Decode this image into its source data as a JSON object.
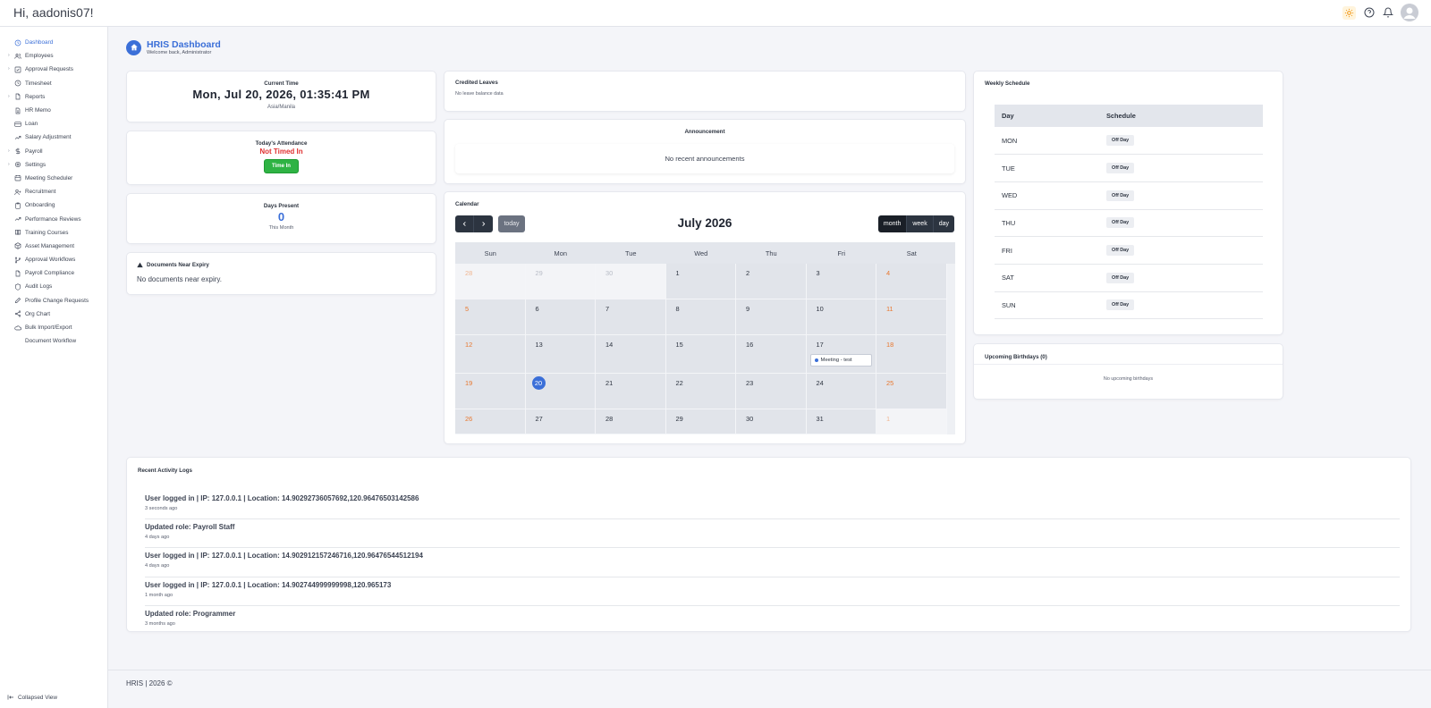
{
  "header": {
    "greeting": "Hi, aadonis07!",
    "icons": [
      "sun-icon",
      "help-icon",
      "bell-icon",
      "user-avatar"
    ]
  },
  "colors": {
    "accent": "#3b6fd8",
    "danger": "#e03131",
    "success": "#2fb344",
    "weekend": "#e8772e",
    "dark_button": "#2c3440"
  },
  "sidebar": {
    "items": [
      {
        "label": "Dashboard",
        "icon": "clock-icon",
        "expandable": false,
        "active": true
      },
      {
        "label": "Employees",
        "icon": "users-icon",
        "expandable": true,
        "active": false
      },
      {
        "label": "Approval Requests",
        "icon": "check-square-icon",
        "expandable": true,
        "active": false
      },
      {
        "label": "Timesheet",
        "icon": "clock-icon",
        "expandable": false,
        "active": false
      },
      {
        "label": "Reports",
        "icon": "file-icon",
        "expandable": true,
        "active": false
      },
      {
        "label": "HR Memo",
        "icon": "file-text-icon",
        "expandable": false,
        "active": false
      },
      {
        "label": "Loan",
        "icon": "credit-card-icon",
        "expandable": false,
        "active": false
      },
      {
        "label": "Salary Adjustment",
        "icon": "trending-up-icon",
        "expandable": false,
        "active": false
      },
      {
        "label": "Payroll",
        "icon": "dollar-icon",
        "expandable": true,
        "active": false
      },
      {
        "label": "Settings",
        "icon": "gear-icon",
        "expandable": true,
        "active": false
      },
      {
        "label": "Meeting Scheduler",
        "icon": "calendar-icon",
        "expandable": false,
        "active": false
      },
      {
        "label": "Recruitment",
        "icon": "user-plus-icon",
        "expandable": false,
        "active": false
      },
      {
        "label": "Onboarding",
        "icon": "clipboard-icon",
        "expandable": false,
        "active": false
      },
      {
        "label": "Performance Reviews",
        "icon": "trending-up-icon",
        "expandable": false,
        "active": false
      },
      {
        "label": "Training Courses",
        "icon": "book-icon",
        "expandable": false,
        "active": false
      },
      {
        "label": "Asset Management",
        "icon": "package-icon",
        "expandable": false,
        "active": false
      },
      {
        "label": "Approval Workflows",
        "icon": "git-branch-icon",
        "expandable": false,
        "active": false
      },
      {
        "label": "Payroll Compliance",
        "icon": "file-icon",
        "expandable": false,
        "active": false
      },
      {
        "label": "Audit Logs",
        "icon": "shield-icon",
        "expandable": false,
        "active": false
      },
      {
        "label": "Profile Change Requests",
        "icon": "edit-icon",
        "expandable": false,
        "active": false
      },
      {
        "label": "Org Chart",
        "icon": "share-icon",
        "expandable": false,
        "active": false
      },
      {
        "label": "Bulk Import/Export",
        "icon": "cloud-icon",
        "expandable": false,
        "active": false
      },
      {
        "label": "Document Workflow",
        "icon": "",
        "expandable": false,
        "active": false
      }
    ],
    "collapse_label": "Collapsed View"
  },
  "page": {
    "title": "HRIS Dashboard",
    "subtitle": "Welcome back, Administrator"
  },
  "current_time": {
    "label": "Current Time",
    "value": "Mon, Jul 20, 2026, 01:35:41 PM",
    "timezone": "Asia/Manila"
  },
  "attendance": {
    "label": "Today's Attendance",
    "status": "Not Timed In",
    "button": "Time In"
  },
  "days_present": {
    "label": "Days Present",
    "value": "0",
    "sub": "This Month"
  },
  "documents": {
    "title": "Documents Near Expiry",
    "message": "No documents near expiry."
  },
  "credited_leaves": {
    "title": "Credited Leaves",
    "message": "No leave balance data"
  },
  "announcement": {
    "title": "Announcement",
    "message": "No recent announcements"
  },
  "calendar": {
    "title": "Calendar",
    "month_title": "July 2026",
    "prev": "‹",
    "next": "›",
    "today": "today",
    "views": [
      "month",
      "week",
      "day"
    ],
    "active_view": "month",
    "weekdays": [
      "Sun",
      "Mon",
      "Tue",
      "Wed",
      "Thu",
      "Fri",
      "Sat"
    ],
    "weeks": [
      [
        {
          "d": "28",
          "o": true
        },
        {
          "d": "29",
          "o": true
        },
        {
          "d": "30",
          "o": true
        },
        {
          "d": "1"
        },
        {
          "d": "2"
        },
        {
          "d": "3"
        },
        {
          "d": "4"
        }
      ],
      [
        {
          "d": "5"
        },
        {
          "d": "6"
        },
        {
          "d": "7"
        },
        {
          "d": "8"
        },
        {
          "d": "9"
        },
        {
          "d": "10"
        },
        {
          "d": "11"
        }
      ],
      [
        {
          "d": "12"
        },
        {
          "d": "13"
        },
        {
          "d": "14"
        },
        {
          "d": "15"
        },
        {
          "d": "16"
        },
        {
          "d": "17",
          "event": "Meeting - test"
        },
        {
          "d": "18"
        }
      ],
      [
        {
          "d": "19"
        },
        {
          "d": "20",
          "today": true
        },
        {
          "d": "21"
        },
        {
          "d": "22"
        },
        {
          "d": "23"
        },
        {
          "d": "24"
        },
        {
          "d": "25"
        }
      ],
      [
        {
          "d": "26"
        },
        {
          "d": "27"
        },
        {
          "d": "28"
        },
        {
          "d": "29"
        },
        {
          "d": "30"
        },
        {
          "d": "31"
        },
        {
          "d": "1",
          "o": true
        }
      ]
    ]
  },
  "weekly_schedule": {
    "title": "Weekly Schedule",
    "columns": [
      "Day",
      "Schedule"
    ],
    "rows": [
      {
        "day": "MON",
        "schedule": "Off Day"
      },
      {
        "day": "TUE",
        "schedule": "Off Day"
      },
      {
        "day": "WED",
        "schedule": "Off Day"
      },
      {
        "day": "THU",
        "schedule": "Off Day"
      },
      {
        "day": "FRI",
        "schedule": "Off Day"
      },
      {
        "day": "SAT",
        "schedule": "Off Day"
      },
      {
        "day": "SUN",
        "schedule": "Off Day"
      }
    ]
  },
  "birthdays": {
    "title": "Upcoming Birthdays (0)",
    "message": "No upcoming birthdays"
  },
  "activity_logs": {
    "title": "Recent Activity Logs",
    "items": [
      {
        "text": "User logged in | IP: 127.0.0.1 | Location: 14.90292736057692,120.96476503142586",
        "time": "3 seconds ago"
      },
      {
        "text": "Updated role: Payroll Staff",
        "time": "4 days ago"
      },
      {
        "text": "User logged in | IP: 127.0.0.1 | Location: 14.902912157246716,120.96476544512194",
        "time": "4 days ago"
      },
      {
        "text": "User logged in | IP: 127.0.0.1 | Location: 14.902744999999998,120.965173",
        "time": "1 month ago"
      },
      {
        "text": "Updated role: Programmer",
        "time": "3 months ago"
      }
    ]
  },
  "footer": {
    "text": "HRIS  |  2026 ©"
  }
}
